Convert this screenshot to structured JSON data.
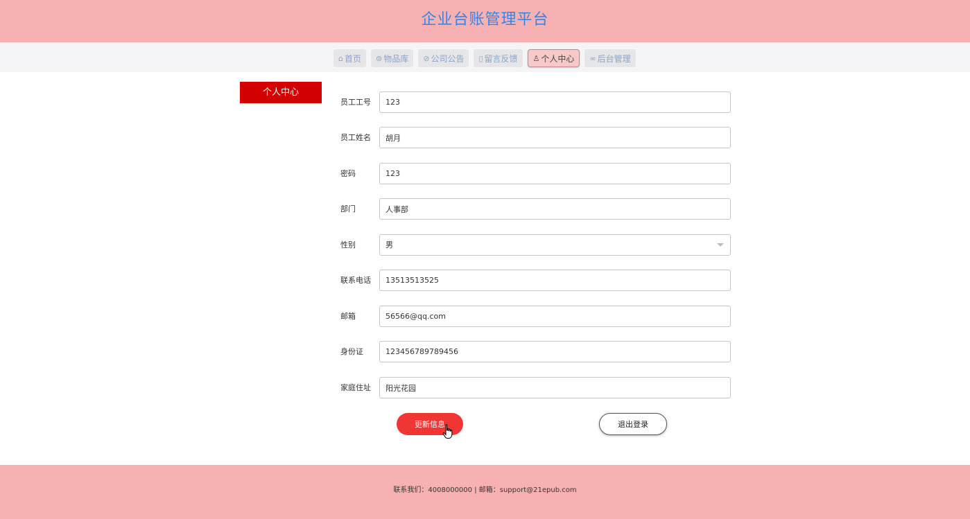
{
  "header": {
    "title": "企业台账管理平台"
  },
  "nav": {
    "items": [
      {
        "icon": "home-icon",
        "glyph": "⌂",
        "label": "首页"
      },
      {
        "icon": "box-icon",
        "glyph": "⊜",
        "label": "物品库"
      },
      {
        "icon": "announcement-icon",
        "glyph": "⊘",
        "label": "公司公告"
      },
      {
        "icon": "note-icon",
        "glyph": "▯",
        "label": "留言反馈"
      },
      {
        "icon": "user-icon",
        "glyph": "♙",
        "label": "个人中心"
      },
      {
        "icon": "link-icon",
        "glyph": "∞",
        "label": "后台管理"
      }
    ],
    "active_index": 4
  },
  "side": {
    "title": "个人中心"
  },
  "form": {
    "fields": [
      {
        "label": "员工工号",
        "value": "123"
      },
      {
        "label": "员工姓名",
        "value": "胡月"
      },
      {
        "label": "密码",
        "value": "123"
      },
      {
        "label": "部门",
        "value": "人事部"
      },
      {
        "label": "性别",
        "value": "男"
      },
      {
        "label": "联系电话",
        "value": "13513513525"
      },
      {
        "label": "邮箱",
        "value": "56566@qq.com"
      },
      {
        "label": "身份证",
        "value": "123456789789456"
      },
      {
        "label": "家庭住址",
        "value": "阳光花园"
      }
    ],
    "update_label": "更新信息",
    "logout_label": "退出登录"
  },
  "footer": {
    "text": "联系我们：4008000000 | 邮箱：support@21epub.com"
  },
  "colors": {
    "header_bg": "#f7b1b3",
    "title": "#3c83dd",
    "side_title_bg": "#d20000",
    "update_button": "#f03535"
  }
}
